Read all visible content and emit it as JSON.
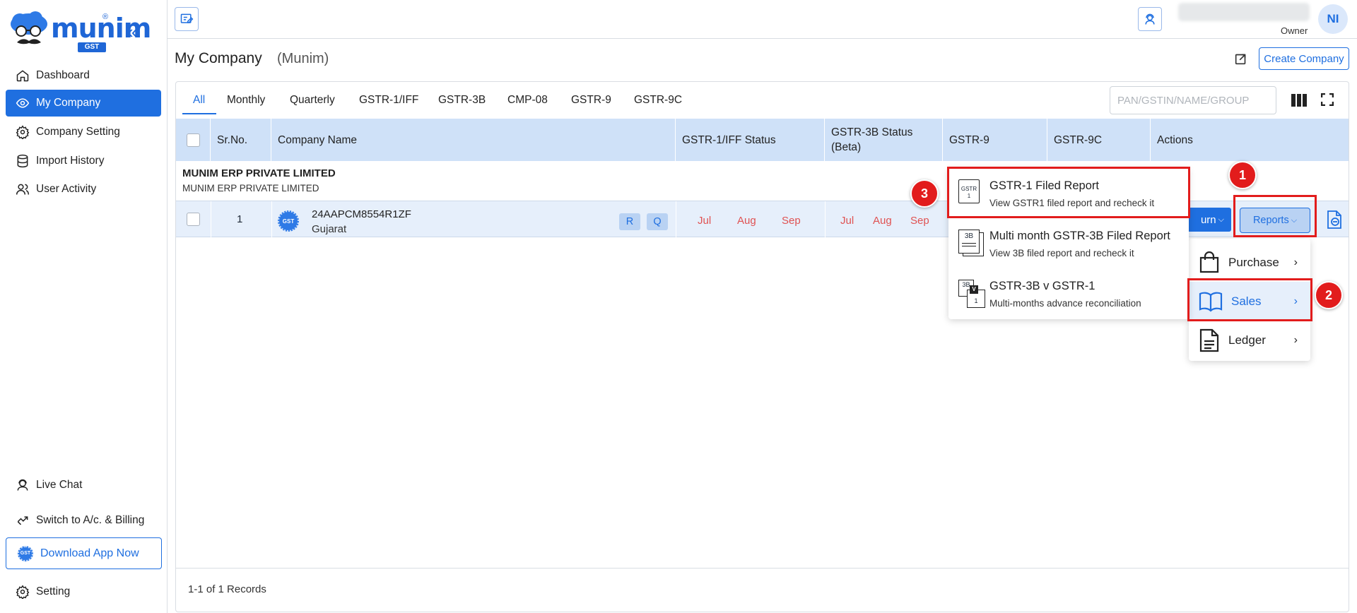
{
  "brand": {
    "name": "munim",
    "reg": "®",
    "tag": "GST"
  },
  "sidebar": {
    "items": [
      {
        "label": "Dashboard",
        "icon": "home-icon"
      },
      {
        "label": "My Company",
        "icon": "eye-icon"
      },
      {
        "label": "Company Setting",
        "icon": "gear-icon"
      },
      {
        "label": "Import History",
        "icon": "database-icon"
      },
      {
        "label": "User Activity",
        "icon": "users-icon"
      }
    ],
    "live_chat": "Live Chat",
    "switch": "Switch to A/c. & Billing",
    "download": "Download App Now",
    "download_badge": "GST",
    "setting": "Setting"
  },
  "topbar": {
    "role": "Owner",
    "avatar": "NI"
  },
  "header": {
    "title": "My Company",
    "subtitle": "(Munim)",
    "create_label": "Create Company"
  },
  "tabs": [
    "All",
    "Monthly",
    "Quarterly",
    "GSTR-1/IFF",
    "GSTR-3B",
    "CMP-08",
    "GSTR-9",
    "GSTR-9C"
  ],
  "search": {
    "placeholder": "PAN/GSTIN/NAME/GROUP"
  },
  "table": {
    "columns": [
      "Sr.No.",
      "Company Name",
      "GSTR-1/IFF Status",
      "GSTR-3B Status (Beta)",
      "GSTR-9",
      "GSTR-9C",
      "Actions"
    ],
    "group": {
      "name": "MUNIM ERP PRIVATE LIMITED",
      "sub": "MUNIM ERP PRIVATE LIMITED"
    },
    "rows": [
      {
        "sr": "1",
        "logo_text": "GST",
        "gstin": "24AAPCM8554R1ZF",
        "state": "Gujarat",
        "tags": [
          "R",
          "Q"
        ],
        "gstr1_months": [
          "Jul",
          "Aug",
          "Sep"
        ],
        "gstr3b_months": [
          "Jul",
          "Aug",
          "Sep"
        ],
        "return_label": "urn",
        "reports_label": "Reports"
      }
    ],
    "records": "1-1 of 1 Records"
  },
  "reports_menu": [
    {
      "title": "GSTR-1 Filed Report",
      "desc": "View GSTR1 filed report and recheck it",
      "icon": "gstr1-doc-icon",
      "icon_text": "GSTR 1"
    },
    {
      "title": "Multi month GSTR-3B Filed Report",
      "desc": "View 3B filed report and recheck it",
      "icon": "3b-stack-icon",
      "icon_text": "3B"
    },
    {
      "title": "GSTR-3B v GSTR-1",
      "desc": "Multi-months advance reconciliation",
      "icon": "3b-v-1-icon",
      "icon_text": [
        "3B",
        "V",
        "1"
      ]
    }
  ],
  "reports_submenu": [
    {
      "label": "Purchase",
      "icon": "shopping-bag-icon"
    },
    {
      "label": "Sales",
      "icon": "open-book-icon"
    },
    {
      "label": "Ledger",
      "icon": "document-icon"
    }
  ],
  "annotations": [
    "1",
    "2",
    "3"
  ],
  "colors": {
    "primary": "#1f6fe0",
    "header_bg": "#cfe1f8",
    "row_bg": "#e6effb",
    "month_red": "#e05252",
    "annotation_red": "#e21c1c"
  }
}
